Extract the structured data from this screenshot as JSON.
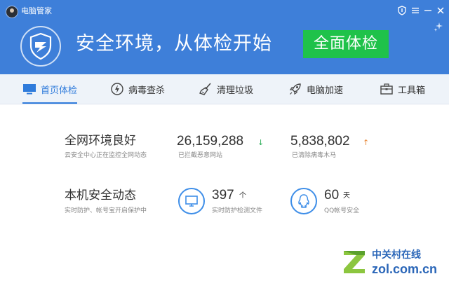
{
  "titlebar": {
    "app_title": "电脑管家",
    "icons": [
      "shield-icon",
      "menu-icon",
      "minimize-icon",
      "close-icon",
      "sparkle-icon"
    ]
  },
  "hero": {
    "headline": "安全环境，从体检开始",
    "scan_button": "全面体检"
  },
  "nav": {
    "items": [
      {
        "label": "首页体检",
        "icon": "monitor-icon",
        "active": true
      },
      {
        "label": "病毒查杀",
        "icon": "lightning-icon",
        "active": false
      },
      {
        "label": "清理垃圾",
        "icon": "broom-icon",
        "active": false
      },
      {
        "label": "电脑加速",
        "icon": "rocket-icon",
        "active": false
      },
      {
        "label": "工具箱",
        "icon": "toolbox-icon",
        "active": false
      }
    ]
  },
  "network": {
    "title": "全网环境良好",
    "subtitle": "云安全中心正在监控全网动态",
    "blocked_count": "26,159,288",
    "blocked_label": "已拦截恶意网站",
    "cleared_count": "5,838,802",
    "cleared_label": "已清除病毒木马"
  },
  "local": {
    "title": "本机安全动态",
    "subtitle": "实时防护、帐号宝开启保护中",
    "files_count": "397",
    "files_unit": "个",
    "files_label": "实时防护检测文件",
    "days_count": "60",
    "days_unit": "天",
    "days_label": "QQ帐号安全"
  },
  "watermark": {
    "top": "中关村在线",
    "bottom": "zol.com.cn"
  },
  "colors": {
    "header_blue": "#3e7fd9",
    "scan_green": "#1fc24a",
    "active_blue": "#2f7bdb",
    "arrow_down": "#2fae5a",
    "arrow_up": "#e8893a"
  }
}
